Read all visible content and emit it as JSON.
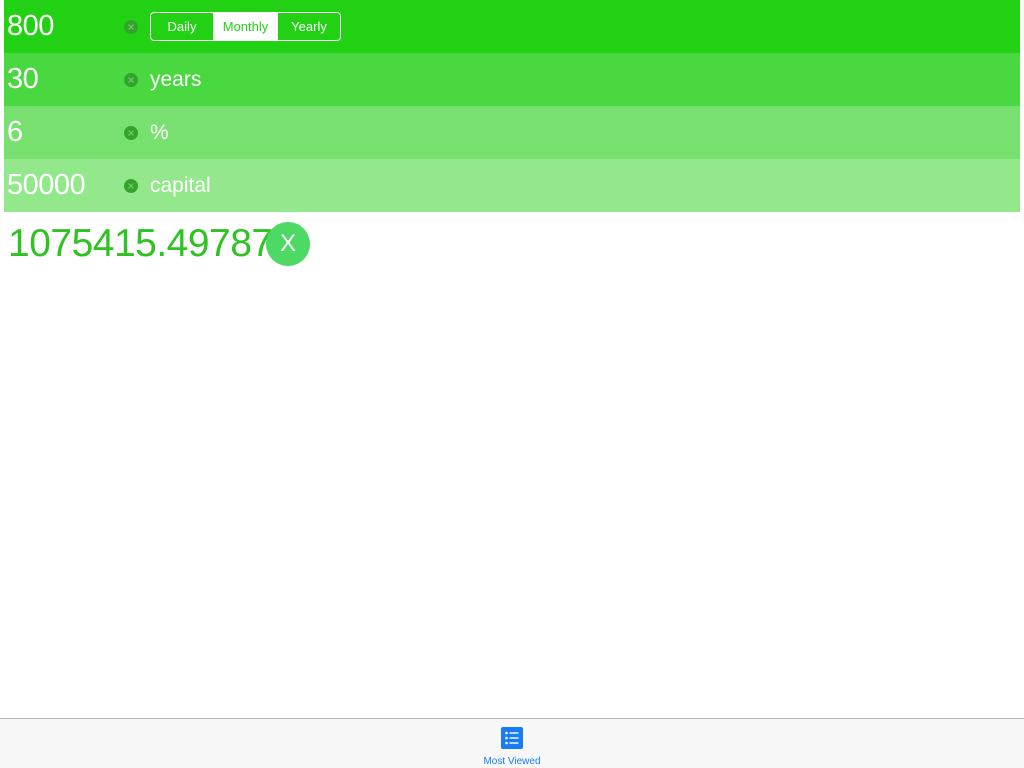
{
  "colors": {
    "row1": "#22d113",
    "row2": "#4ad840",
    "row3": "#78e06e",
    "row4": "#94e88c",
    "clear_icon": "#33a42a",
    "result_text": "#2ec222",
    "reset_button_bg": "#4cd964",
    "tab_accent": "#1a7cf5"
  },
  "inputs": [
    {
      "value": "800",
      "clear_icon": "circle-x-icon",
      "unit": "",
      "has_period": true
    },
    {
      "value": "30",
      "clear_icon": "circle-x-icon",
      "unit": "years"
    },
    {
      "value": "6",
      "clear_icon": "circle-x-icon",
      "unit": "%"
    },
    {
      "value": "50000",
      "clear_icon": "circle-x-icon",
      "unit": "capital"
    }
  ],
  "period": {
    "options": [
      "Daily",
      "Monthly",
      "Yearly"
    ],
    "selected": "Monthly"
  },
  "result": {
    "value": "1075415.49787",
    "reset_label": "X"
  },
  "tabbar": {
    "items": [
      {
        "label": "Most Viewed",
        "icon": "list-icon",
        "selected": true
      }
    ]
  }
}
